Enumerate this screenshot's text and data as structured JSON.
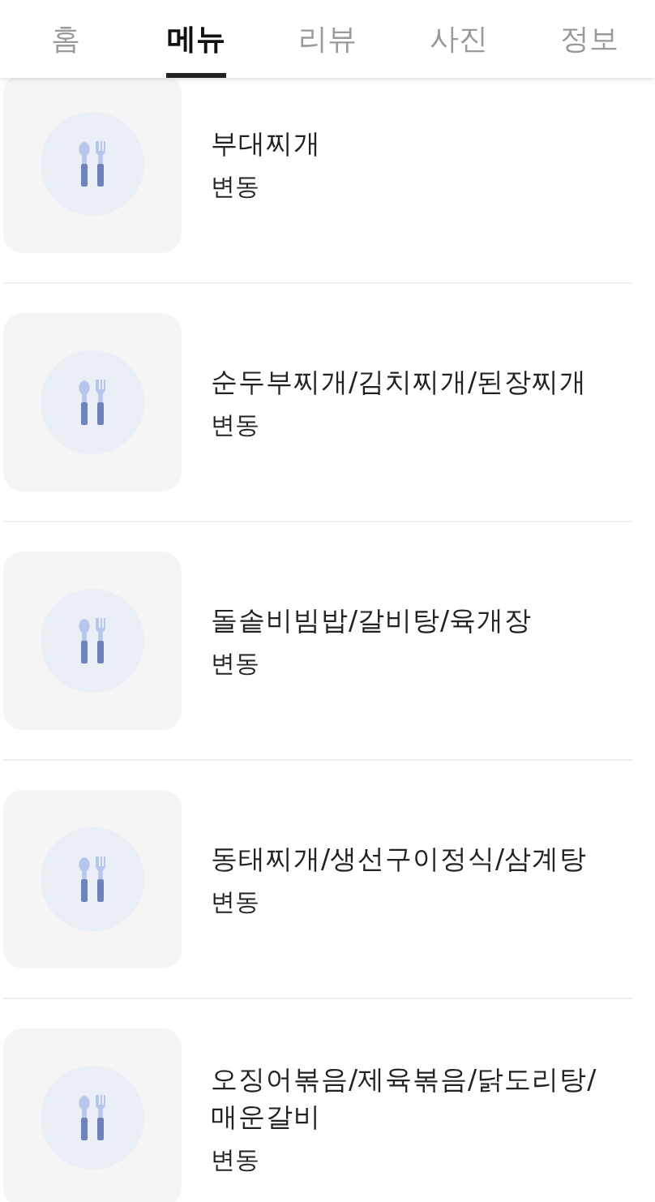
{
  "tabs": [
    {
      "label": "홈",
      "selected": false
    },
    {
      "label": "메뉴",
      "selected": true
    },
    {
      "label": "리뷰",
      "selected": false
    },
    {
      "label": "사진",
      "selected": false
    },
    {
      "label": "정보",
      "selected": false
    }
  ],
  "menu_items": [
    {
      "name": "부대찌개",
      "price": "변동"
    },
    {
      "name": "순두부찌개/김치찌개/된장찌개",
      "price": "변동"
    },
    {
      "name": "돌솥비빔밥/갈비탕/육개장",
      "price": "변동"
    },
    {
      "name": "동태찌개/생선구이정식/삼계탕",
      "price": "변동"
    },
    {
      "name": "오징어볶음/제육볶음/닭도리탕/매운갈비",
      "price": "변동"
    }
  ]
}
